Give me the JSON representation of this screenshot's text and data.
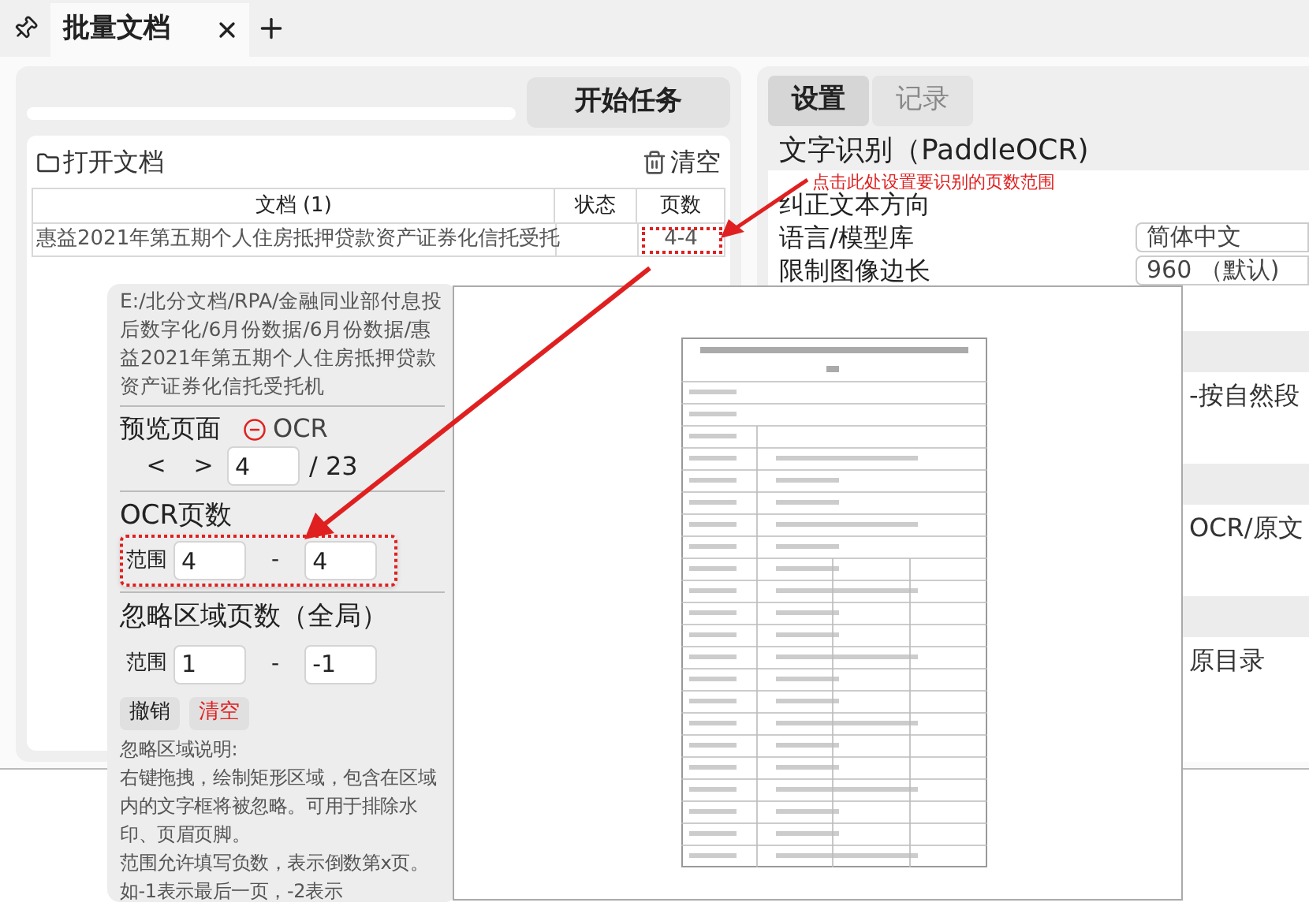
{
  "tab_bar": {
    "tabs": [
      {
        "label": "批量文档",
        "selected": true
      }
    ]
  },
  "task_panel": {
    "progress": {
      "level": 0
    },
    "start_button": "开始任务",
    "open_button": "打开文档",
    "clear_button": "清空",
    "table": {
      "columns": [
        "文档 (1)",
        "状态",
        "页数"
      ],
      "rows": [
        {
          "cells": [
            {
              "text": "惠益2021年第五期个人住房抵押贷款资产证券化信托受托",
              "highlighted": false
            },
            {
              "text": "",
              "highlighted": false
            },
            {
              "text": "4-4",
              "highlighted": true
            }
          ]
        }
      ]
    }
  },
  "annotation": {
    "text": "点击此处设置要识别的页数范围"
  },
  "settings_panel": {
    "tabs": [
      {
        "label": "设置",
        "selected": true
      },
      {
        "label": "记录",
        "selected": false
      }
    ],
    "section_title": "文字识别（PaddleOCR)",
    "rows": [
      {
        "kind": "label",
        "label": "纠正文本方向"
      },
      {
        "kind": "select",
        "label": "语言/模型库",
        "value": "简体中文"
      },
      {
        "kind": "select",
        "label": "限制图像边长",
        "value": "960 （默认)"
      }
    ],
    "fragments": [
      "-按自然段",
      "OCR/原文",
      "原目录"
    ]
  },
  "preview_popup": {
    "path": "E:/北分文档/RPA/金融同业部付息投后数字化/6月份数据/6月份数据/惠益2021年第五期个人住房抵押贷款资产证券化信托受托机",
    "preview_label": "预览页面",
    "ocr_toggle": "OCR",
    "prev": "<",
    "next": ">",
    "page": "4",
    "page_total": "/ 23",
    "ocr_pages": {
      "title": "OCR页数",
      "range_label": "范围",
      "from": "4",
      "separator": "-",
      "to": "4",
      "highlighted": true
    },
    "ignore_pages": {
      "title": "忽略区域页数（全局）",
      "range_label": "范围",
      "from": "1",
      "separator": "-",
      "to": "-1",
      "highlighted": false
    },
    "buttons": [
      {
        "label": "撤销",
        "kind": "normal"
      },
      {
        "label": "清空",
        "kind": "danger"
      }
    ],
    "note": [
      "忽略区域说明:",
      "右键拖拽，绘制矩形区域，包含在区域内的文字框将被忽略。可用于排除水印、页眉页脚。",
      "范围允许填写负数，表示倒数第x页。如-1表示最后一页，-2表示"
    ]
  }
}
